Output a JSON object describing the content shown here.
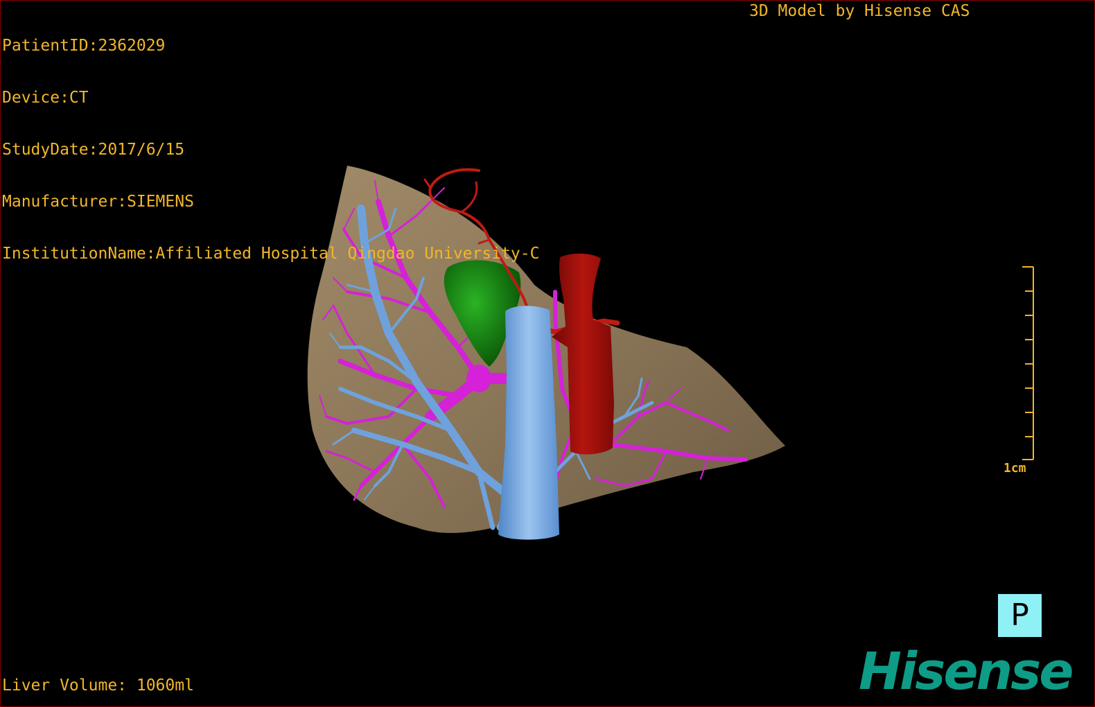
{
  "patient_info": {
    "patient_id": "PatientID:2362029",
    "device": "Device:CT",
    "study_date": "StudyDate:2017/6/15",
    "manufacturer": "Manufacturer:SIEMENS",
    "institution": "InstitutionName:Affiliated Hospital Qingdao University-C"
  },
  "brand_caption": "3D Model by Hisense CAS",
  "liver_volume": "Liver Volume: 1060ml",
  "scale_bar": {
    "label": "1cm"
  },
  "orientation_button": {
    "label": "P"
  },
  "logo": {
    "text": "Hisense"
  },
  "colors": {
    "overlay_text": "#f2b62a",
    "liver": "#8b7658",
    "portal_vein": "#d521d8",
    "hepatic_vein": "#6fa2dc",
    "ivc": "#7aa8e0",
    "aorta": "#a5120f",
    "hepatic_artery": "#c01a14",
    "gallbladder": "#1a8f14",
    "orientation_bg": "#8ff0f6",
    "logo": "#0e9c87"
  },
  "icons": {
    "orientation": "posterior-view-icon",
    "logo": "hisense-logo"
  }
}
